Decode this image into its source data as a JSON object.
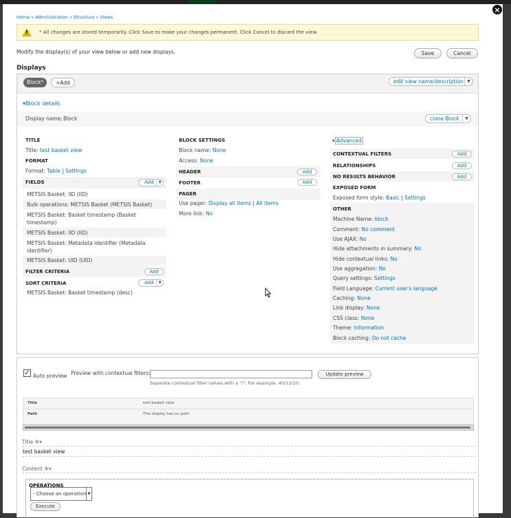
{
  "breadcrumb": {
    "home": "Home",
    "sep": " » ",
    "admin": "Administration",
    "structure": "Structure",
    "views": "Views"
  },
  "close_glyph": "×",
  "warning": {
    "text": "* All changes are stored temporarily. Click Save to make your changes permanent. Click Cancel to discard the view.",
    "icon": "warning-icon",
    "glyph": "!"
  },
  "intro": "Modify the display(s) of your view below or add new displays.",
  "actions": {
    "save": "Save",
    "cancel": "Cancel"
  },
  "displays": {
    "heading": "Displays",
    "active_tab": "Block*",
    "add_tab": "+Add",
    "edit_name": "edit view name/description",
    "block_details": "Block details",
    "display_name_label": "Display name:",
    "display_name_value": "Block",
    "clone": "clone Block"
  },
  "left_col": {
    "title_h": "TITLE",
    "title_label": "Title:",
    "title_value": "test basket view",
    "format_h": "FORMAT",
    "format_label": "Format:",
    "format_value": "Table",
    "format_sep": "|",
    "format_settings": "Settings",
    "fields_h": "FIELDS",
    "fields_add": "Add",
    "fields": [
      "METSIS Basket: IID (IID)",
      "Bulk operations: METSIS Basket (METSIS Basket)",
      "METSIS Basket: Basket timestamp (Basket timestamp)",
      "METSIS Basket: IID (IID)",
      "METSIS Basket: Metadata identifier (Metadata identifier)",
      "METSIS Basket: UID (UID)"
    ],
    "filter_h": "FILTER CRITERIA",
    "filter_add": "Add",
    "sort_h": "SORT CRITERIA",
    "sort_add": "Add",
    "sort_item": "METSIS Basket: Basket timestamp (desc)"
  },
  "mid_col": {
    "block_settings_h": "BLOCK SETTINGS",
    "block_name_label": "Block name:",
    "block_name_value": "None",
    "access_label": "Access:",
    "access_value": "None",
    "header_h": "HEADER",
    "header_add": "Add",
    "footer_h": "FOOTER",
    "footer_add": "Add",
    "pager_h": "PAGER",
    "use_pager_label": "Use pager:",
    "use_pager_value": "Display all items",
    "use_pager_sep": "|",
    "use_pager_value2": "All items",
    "more_link_label": "More link:",
    "more_link_value": "No"
  },
  "right_col": {
    "advanced": "Advanced",
    "contextual_h": "CONTEXTUAL FILTERS",
    "contextual_add": "Add",
    "relationships_h": "RELATIONSHIPS",
    "relationships_add": "Add",
    "noresults_h": "NO RESULTS BEHAVIOR",
    "noresults_add": "Add",
    "exposed_h": "EXPOSED FORM",
    "exposed_label": "Exposed form style:",
    "exposed_value": "Basic",
    "exposed_sep": "|",
    "exposed_settings": "Settings",
    "other_h": "OTHER",
    "other": [
      {
        "label": "Machine Name:",
        "value": "block"
      },
      {
        "label": "Comment:",
        "value": "No comment"
      },
      {
        "label": "Use AJAX:",
        "value": "No"
      },
      {
        "label": "Hide attachments in summary:",
        "value": "No"
      },
      {
        "label": "Hide contextual links:",
        "value": "No"
      },
      {
        "label": "Use aggregation:",
        "value": "No"
      },
      {
        "label": "Query settings:",
        "value": "Settings"
      },
      {
        "label": "Field Language:",
        "value": "Current user's language"
      },
      {
        "label": "Caching:",
        "value": "None"
      },
      {
        "label": "Link display:",
        "value": "None"
      },
      {
        "label": "CSS class:",
        "value": "None"
      },
      {
        "label": "Theme:",
        "value": "Information"
      },
      {
        "label": "Block caching:",
        "value": "Do not cache"
      }
    ]
  },
  "preview": {
    "auto_preview": "Auto preview",
    "auto_checked": true,
    "check_glyph": "✓",
    "contextual_label": "Preview with contextual filters:",
    "contextual_value": "",
    "update": "Update preview",
    "help": "Separate contextual filter values with a \"/\". For example, 40/12/10.",
    "table": [
      {
        "label": "Title",
        "value": "test basket view"
      },
      {
        "label": "Path",
        "value": "This display has no path."
      }
    ],
    "title_h": "Title",
    "title_value": "test basket view",
    "content_h": "Content",
    "operations_h": "OPERATIONS",
    "operation_select": "- Choose an operation -",
    "execute": "Execute"
  }
}
